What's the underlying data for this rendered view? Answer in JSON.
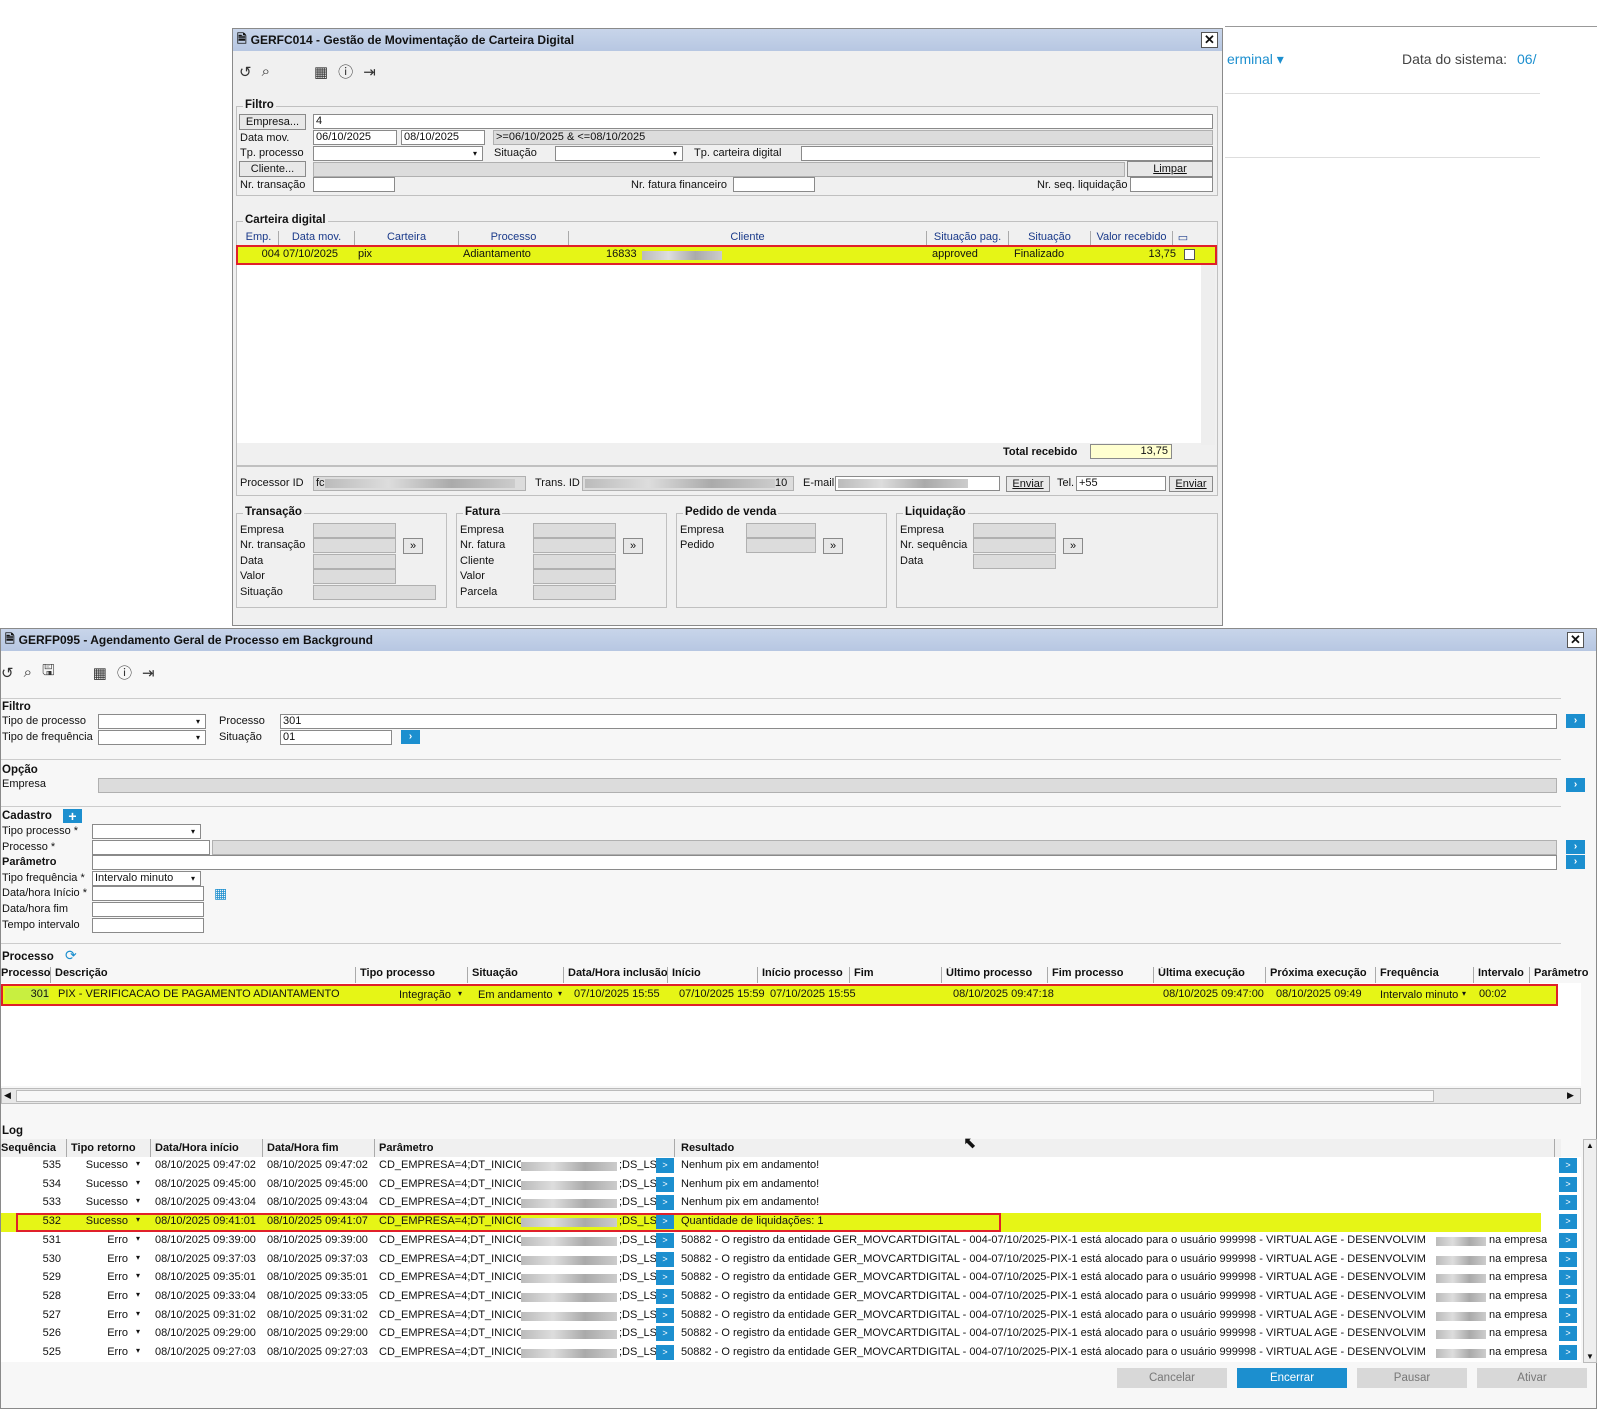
{
  "bg": {
    "terminal": "erminal",
    "data_label": "Data do sistema:",
    "data_val": "06/"
  },
  "w1": {
    "title": "GERFC014 - Gestão de Movimentação de Carteira Digital",
    "filtro": {
      "title": "Filtro",
      "empresa_btn": "Empresa...",
      "empresa_val": "4",
      "data_mov": "Data mov.",
      "d1": "06/10/2025",
      "d2": "08/10/2025",
      "expr": ">=06/10/2025 & <=08/10/2025",
      "tp_proc": "Tp. processo",
      "situacao": "Situação",
      "tp_cart": "Tp. carteira digital",
      "cliente_btn": "Cliente...",
      "limpar": "Limpar",
      "nr_trans": "Nr. transação",
      "nr_fat": "Nr. fatura financeiro",
      "nr_seq": "Nr. seq. liquidação"
    },
    "carteira": {
      "title": "Carteira digital",
      "cols": [
        "Emp.",
        "Data mov.",
        "Carteira",
        "Processo",
        "Cliente",
        "Situação pag.",
        "Situação",
        "Valor recebido"
      ],
      "row": {
        "emp": "004",
        "data": "07/10/2025",
        "cart": "pix",
        "proc": "Adiantamento",
        "cli": "16833",
        "sitpag": "approved",
        "sit": "Finalizado",
        "valor": "13,75"
      },
      "total_label": "Total recebido",
      "total": "13,75"
    },
    "ids": {
      "proc_label": "Processor ID",
      "proc_val": "fc",
      "trans_label": "Trans. ID",
      "trans_val": "10",
      "email_label": "E-mail",
      "enviar": "Enviar",
      "tel_label": "Tel.",
      "tel_val": "+55"
    },
    "trans": {
      "title": "Transação",
      "l": [
        "Empresa",
        "Nr. transação",
        "Data",
        "Valor",
        "Situação"
      ]
    },
    "fatura": {
      "title": "Fatura",
      "l": [
        "Empresa",
        "Nr. fatura",
        "Cliente",
        "Valor",
        "Parcela"
      ]
    },
    "pedido": {
      "title": "Pedido de venda",
      "l": [
        "Empresa",
        "Pedido"
      ]
    },
    "liq": {
      "title": "Liquidação",
      "l": [
        "Empresa",
        "Nr. sequência",
        "Data"
      ]
    },
    "more": "»"
  },
  "w2": {
    "title": "GERFP095 - Agendamento Geral de Processo em Background",
    "filtro": {
      "title": "Filtro",
      "tipo_proc": "Tipo de processo",
      "tipo_freq": "Tipo de frequência",
      "processo": "Processo",
      "proc_val": "301",
      "situacao": "Situação",
      "sit_val": "01"
    },
    "opcao": {
      "title": "Opção",
      "empresa": "Empresa"
    },
    "cadastro": {
      "title": "Cadastro",
      "tipo_proc": "Tipo processo *",
      "processo": "Processo *",
      "parametro": "Parâmetro",
      "tipo_freq": "Tipo frequência *",
      "freq_val": "Intervalo minuto",
      "dt_ini": "Data/hora Início *",
      "dt_fim": "Data/hora fim",
      "tempo": "Tempo intervalo"
    },
    "processo": {
      "title": "Processo",
      "cols": [
        "Processo",
        "Descrição",
        "Tipo processo",
        "Situação",
        "Data/Hora inclusão",
        "Início",
        "Início processo",
        "Fim",
        "Último processo",
        "Fim processo",
        "Última execução",
        "Próxima execução",
        "Frequência",
        "Intervalo",
        "Parâmetro"
      ],
      "row": {
        "proc": "301",
        "desc": "PIX - VERIFICACAO DE PAGAMENTO ADIANTAMENTO",
        "tipo": "Integração",
        "sit": "Em andamento",
        "incl": "07/10/2025 15:55",
        "ini": "07/10/2025 15:59",
        "iniproc": "07/10/2025 15:55",
        "ultproc": "08/10/2025 09:47:18",
        "ultexec": "08/10/2025 09:47:00",
        "prox": "08/10/2025 09:49",
        "freq": "Intervalo minuto",
        "interv": "00:02"
      }
    },
    "log": {
      "title": "Log",
      "cols": [
        "Sequência",
        "Tipo retorno",
        "Data/Hora início",
        "Data/Hora fim",
        "Parâmetro",
        "Resultado"
      ],
      "rows": [
        {
          "seq": "535",
          "tipo": "Sucesso",
          "ini": "08/10/2025 09:47:02",
          "fim": "08/10/2025 09:47:02",
          "param": "CD_EMPRESA=4;DT_INICIO=",
          "dsls": ";DS_LS",
          "res": "Nenhum pix em andamento!"
        },
        {
          "seq": "534",
          "tipo": "Sucesso",
          "ini": "08/10/2025 09:45:00",
          "fim": "08/10/2025 09:45:00",
          "param": "CD_EMPRESA=4;DT_INICIO=",
          "dsls": ";DS_LS",
          "res": "Nenhum pix em andamento!"
        },
        {
          "seq": "533",
          "tipo": "Sucesso",
          "ini": "08/10/2025 09:43:04",
          "fim": "08/10/2025 09:43:04",
          "param": "CD_EMPRESA=4;DT_INICIO=",
          "dsls": ";DS_LS",
          "res": "Nenhum pix em andamento!"
        },
        {
          "seq": "532",
          "tipo": "Sucesso",
          "ini": "08/10/2025 09:41:01",
          "fim": "08/10/2025 09:41:07",
          "param": "CD_EMPRESA=4;DT_INICIO=",
          "dsls": ";DS_LS",
          "res": "Quantidade de liquidações: 1"
        },
        {
          "seq": "531",
          "tipo": "Erro",
          "ini": "08/10/2025 09:39:00",
          "fim": "08/10/2025 09:39:00",
          "param": "CD_EMPRESA=4;DT_INICIO=2",
          "dsls": ";DS_LS",
          "res": "50882 - O registro da entidade GER_MOVCARTDIGITAL - 004-07/10/2025-PIX-1 está alocado para o usuário 999998 - VIRTUAL AGE - DESENVOLVIMENTO",
          "emp": "na empresa"
        },
        {
          "seq": "530",
          "tipo": "Erro",
          "ini": "08/10/2025 09:37:03",
          "fim": "08/10/2025 09:37:03",
          "param": "CD_EMPRESA=4;DT_INICIO=2",
          "dsls": ";DS_LS",
          "res": "50882 - O registro da entidade GER_MOVCARTDIGITAL - 004-07/10/2025-PIX-1 está alocado para o usuário 999998 - VIRTUAL AGE - DESENVOLVIMENTO",
          "emp": "na empresa"
        },
        {
          "seq": "529",
          "tipo": "Erro",
          "ini": "08/10/2025 09:35:01",
          "fim": "08/10/2025 09:35:01",
          "param": "CD_EMPRESA=4;DT_INICIO=2",
          "dsls": ";DS_LS",
          "res": "50882 - O registro da entidade GER_MOVCARTDIGITAL - 004-07/10/2025-PIX-1 está alocado para o usuário 999998 - VIRTUAL AGE - DESENVOLVIMENTO",
          "emp": "na empresa"
        },
        {
          "seq": "528",
          "tipo": "Erro",
          "ini": "08/10/2025 09:33:04",
          "fim": "08/10/2025 09:33:05",
          "param": "CD_EMPRESA=4;DT_INICIO=2",
          "dsls": ";DS_LS",
          "res": "50882 - O registro da entidade GER_MOVCARTDIGITAL - 004-07/10/2025-PIX-1 está alocado para o usuário 999998 - VIRTUAL AGE - DESENVOLVIMENTO",
          "emp": "na empresa"
        },
        {
          "seq": "527",
          "tipo": "Erro",
          "ini": "08/10/2025 09:31:02",
          "fim": "08/10/2025 09:31:02",
          "param": "CD_EMPRESA=4;DT_INICIO=2",
          "dsls": ";DS_LS",
          "res": "50882 - O registro da entidade GER_MOVCARTDIGITAL - 004-07/10/2025-PIX-1 está alocado para o usuário 999998 - VIRTUAL AGE - DESENVOLVIMENTO",
          "emp": "na empresa"
        },
        {
          "seq": "526",
          "tipo": "Erro",
          "ini": "08/10/2025 09:29:00",
          "fim": "08/10/2025 09:29:00",
          "param": "CD_EMPRESA=4;DT_INICIO=2",
          "dsls": ";DS_LS",
          "res": "50882 - O registro da entidade GER_MOVCARTDIGITAL - 004-07/10/2025-PIX-1 está alocado para o usuário 999998 - VIRTUAL AGE - DESENVOLVIMENTO",
          "emp": "na empresa"
        },
        {
          "seq": "525",
          "tipo": "Erro",
          "ini": "08/10/2025 09:27:03",
          "fim": "08/10/2025 09:27:03",
          "param": "CD_EMPRESA=4;DT_INICIO=2",
          "dsls": ";DS_LS",
          "res": "50882 - O registro da entidade GER_MOVCARTDIGITAL - 004-07/10/2025-PIX-1 está alocado para o usuário 999998 - VIRTUAL AGE - DESENVOLVIMENTO",
          "emp": "na empresa"
        }
      ]
    },
    "footer": {
      "cancelar": "Cancelar",
      "encerrar": "Encerrar",
      "pausar": "Pausar",
      "ativar": "Ativar"
    }
  },
  "colors": {
    "highlight": "#e6f516",
    "border_red": "#e0202a",
    "accent_blue": "#1c8fcf"
  }
}
